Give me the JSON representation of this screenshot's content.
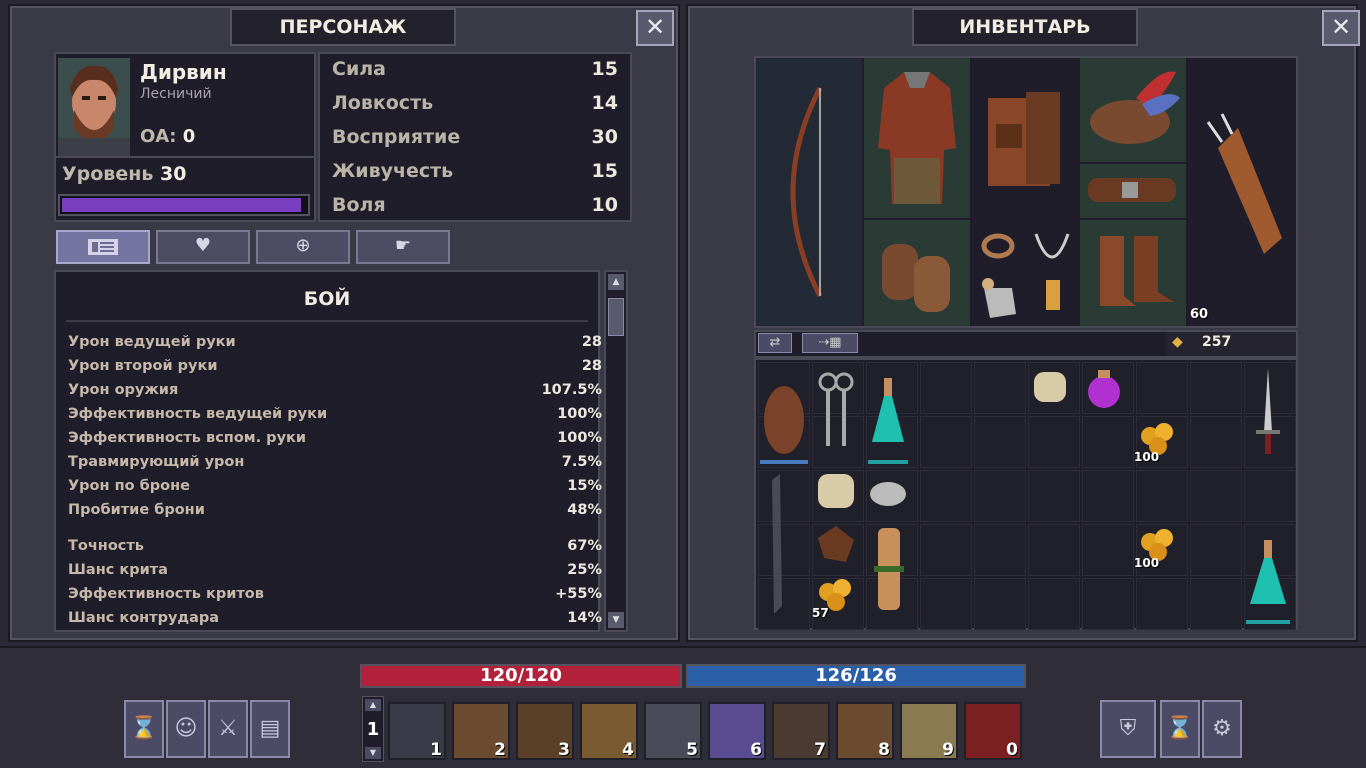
{
  "character_panel": {
    "title": "ПЕРСОНАЖ",
    "close_icon": "close-icon",
    "name": "Дирвин",
    "profession": "Лесничий",
    "oa_label": "ОА:",
    "oa_value": "0",
    "level_label": "Уровень",
    "level_value": "30",
    "xp_fraction": 0.98,
    "attributes": [
      {
        "label": "Сила",
        "value": "15"
      },
      {
        "label": "Ловкость",
        "value": "14"
      },
      {
        "label": "Восприятие",
        "value": "30"
      },
      {
        "label": "Живучесть",
        "value": "15"
      },
      {
        "label": "Воля",
        "value": "10"
      }
    ],
    "tabs": [
      "list-icon",
      "heart-icon",
      "target-icon",
      "hand-icon"
    ],
    "section_title": "БОЙ",
    "stats_group1": [
      {
        "label": "Урон ведущей руки",
        "value": "28"
      },
      {
        "label": "Урон второй руки",
        "value": "28"
      },
      {
        "label": "Урон оружия",
        "value": "107.5%"
      },
      {
        "label": "Эффективность ведущей руки",
        "value": "100%"
      },
      {
        "label": "Эффективность вспом. руки",
        "value": "100%"
      },
      {
        "label": "Травмирующий урон",
        "value": "7.5%"
      },
      {
        "label": "Урон по броне",
        "value": "15%"
      },
      {
        "label": "Пробитие брони",
        "value": "48%"
      }
    ],
    "stats_group2": [
      {
        "label": "Точность",
        "value": "67%"
      },
      {
        "label": "Шанс крита",
        "value": "25%"
      },
      {
        "label": "Эффективность критов",
        "value": "+55%"
      },
      {
        "label": "Шанс контрудара",
        "value": "14%"
      }
    ]
  },
  "inventory_panel": {
    "title": "ИНВЕНТАРЬ",
    "quiver_count": "60",
    "gold_amount": "257",
    "stack_counts": [
      "100",
      "100",
      "57"
    ]
  },
  "bottom_bar": {
    "health": "120/120",
    "health_fraction": 1.0,
    "mana": "126/126",
    "mana_fraction": 1.0,
    "hotbar_page": "1",
    "hotkeys": [
      "1",
      "2",
      "3",
      "4",
      "5",
      "6",
      "7",
      "8",
      "9",
      "0"
    ],
    "colors": {
      "health": "#b3203a",
      "mana": "#2a5fa8",
      "xp": "#7a3fc0"
    }
  }
}
